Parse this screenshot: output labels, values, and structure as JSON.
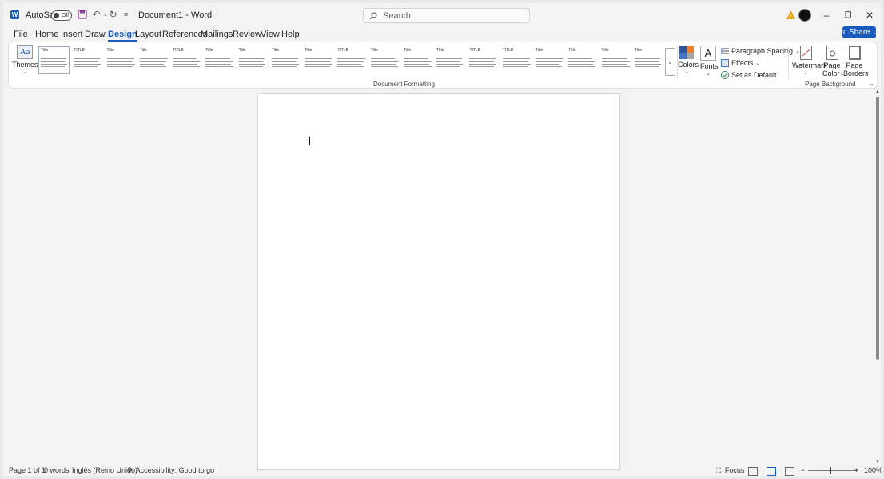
{
  "titlebar": {
    "autosave_label": "AutoSave",
    "autosave_state": "Off",
    "document_title": "Document1  -  Word",
    "search_placeholder": "Search"
  },
  "menu": {
    "tabs": [
      "File",
      "Home",
      "Insert",
      "Draw",
      "Design",
      "Layout",
      "References",
      "Mailings",
      "Review",
      "View",
      "Help"
    ],
    "active_tab": "Design",
    "share_label": "Share"
  },
  "ribbon": {
    "themes_label": "Themes",
    "style_set_titles": [
      "Title",
      "TITLE",
      "Title",
      "Title",
      "TITLE",
      "Title",
      "Title",
      "Title",
      "Title",
      "TITLE",
      "Title",
      "Title",
      "Title",
      "TITLE",
      "TITLE",
      "Title",
      "Title",
      "Title",
      "Title"
    ],
    "colors_label": "Colors",
    "fonts_label": "Fonts",
    "paragraph_spacing_label": "Paragraph Spacing",
    "effects_label": "Effects",
    "set_as_default_label": "Set as Default",
    "document_formatting_label": "Document Formatting",
    "watermark_label": "Watermark",
    "page_color_label_1": "Page",
    "page_color_label_2": "Color",
    "page_borders_label_1": "Page",
    "page_borders_label_2": "Borders",
    "page_background_label": "Page Background"
  },
  "statusbar": {
    "page_info": "Page 1 of 1",
    "word_count": "0 words",
    "language": "Inglês (Reino Unido)",
    "accessibility": "Accessibility: Good to go",
    "focus_label": "Focus",
    "zoom_level": "100%"
  },
  "colors": {
    "accent": "#185abd",
    "share_bg": "#185abd",
    "theme_swatches": [
      "#2f5597",
      "#ed7d31",
      "#4472c4",
      "#a5a5a5"
    ]
  }
}
